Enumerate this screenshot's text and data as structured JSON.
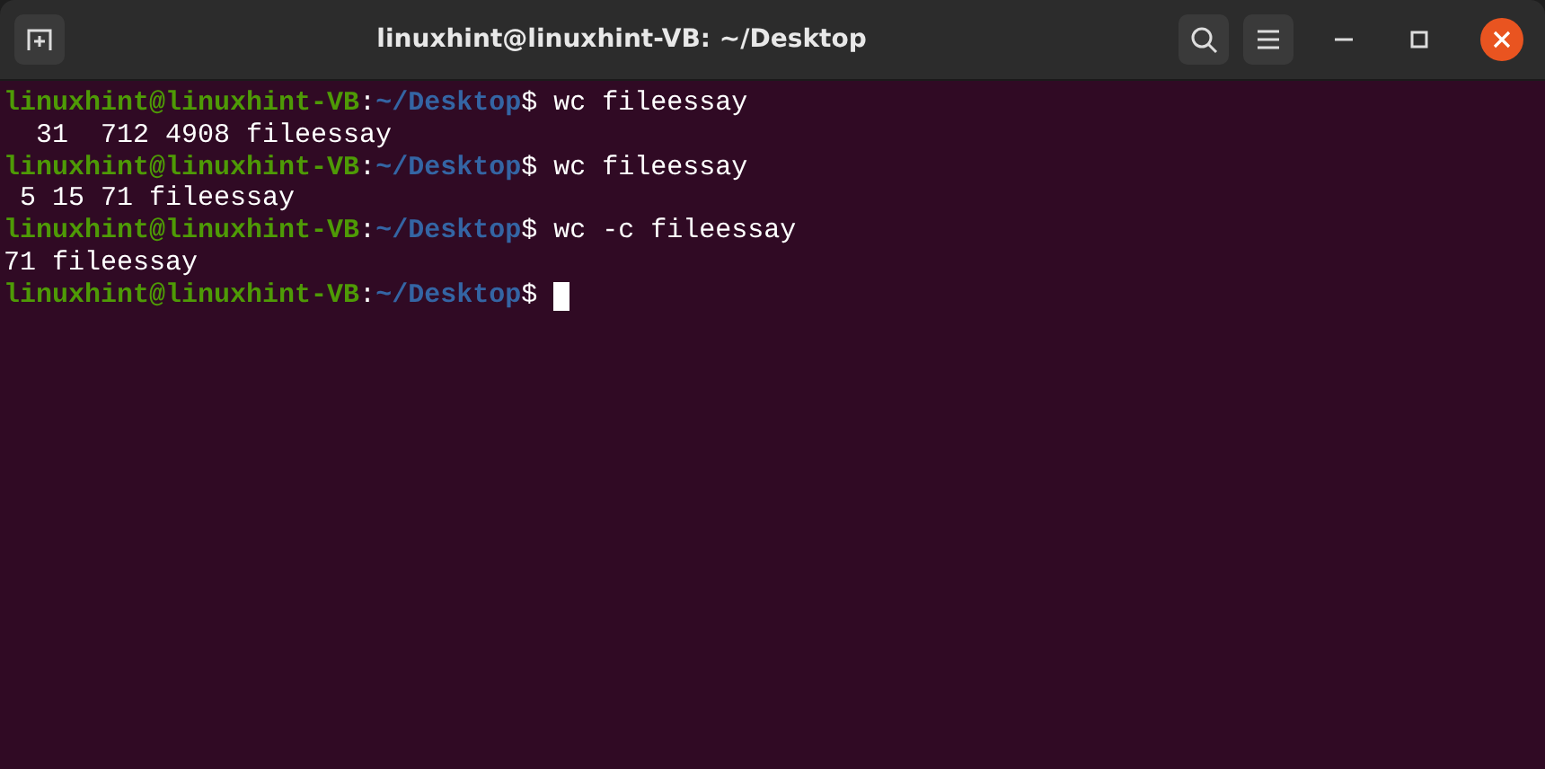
{
  "window": {
    "title": "linuxhint@linuxhint-VB: ~/Desktop"
  },
  "lines": [
    {
      "kind": "prompt",
      "user": "linuxhint@linuxhint-VB",
      "separator": ":",
      "path": "~/Desktop",
      "symbol": "$",
      "command": "wc fileessay"
    },
    {
      "kind": "output",
      "text": "  31  712 4908 fileessay"
    },
    {
      "kind": "prompt",
      "user": "linuxhint@linuxhint-VB",
      "separator": ":",
      "path": "~/Desktop",
      "symbol": "$",
      "command": "wc fileessay"
    },
    {
      "kind": "output",
      "text": " 5 15 71 fileessay"
    },
    {
      "kind": "prompt",
      "user": "linuxhint@linuxhint-VB",
      "separator": ":",
      "path": "~/Desktop",
      "symbol": "$",
      "command": "wc -c fileessay"
    },
    {
      "kind": "output",
      "text": "71 fileessay"
    },
    {
      "kind": "prompt",
      "user": "linuxhint@linuxhint-VB",
      "separator": ":",
      "path": "~/Desktop",
      "symbol": "$",
      "cursor": true
    }
  ]
}
